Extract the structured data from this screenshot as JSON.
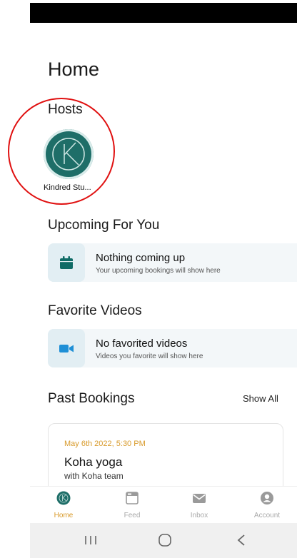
{
  "page": {
    "title": "Home"
  },
  "hosts": {
    "title": "Hosts",
    "items": [
      {
        "name": "Kindred Stu...",
        "avatar_icon": "kindred-logo-icon",
        "avatar_color": "#1e6e68"
      }
    ]
  },
  "upcoming": {
    "title": "Upcoming For You",
    "empty_title": "Nothing coming up",
    "empty_subtitle": "Your upcoming bookings will show here",
    "icon": "calendar-icon"
  },
  "favorites": {
    "title": "Favorite Videos",
    "empty_title": "No favorited videos",
    "empty_subtitle": "Videos you favorite will show here",
    "icon": "video-camera-icon"
  },
  "past_bookings": {
    "title": "Past Bookings",
    "show_all_label": "Show All",
    "items": [
      {
        "date": "May 6th 2022, 5:30 PM",
        "title": "Koha yoga",
        "host": "with Koha team"
      }
    ]
  },
  "tabs": [
    {
      "label": "Home",
      "icon": "kindred-logo-icon",
      "active": true
    },
    {
      "label": "Feed",
      "icon": "feed-icon",
      "active": false
    },
    {
      "label": "Inbox",
      "icon": "mail-icon",
      "active": false
    },
    {
      "label": "Account",
      "icon": "account-icon",
      "active": false
    }
  ],
  "colors": {
    "accent": "#d89a2a",
    "brand_teal": "#1e6e68",
    "icon_teal": "#0f6b66",
    "annotation_red": "#e01010"
  }
}
